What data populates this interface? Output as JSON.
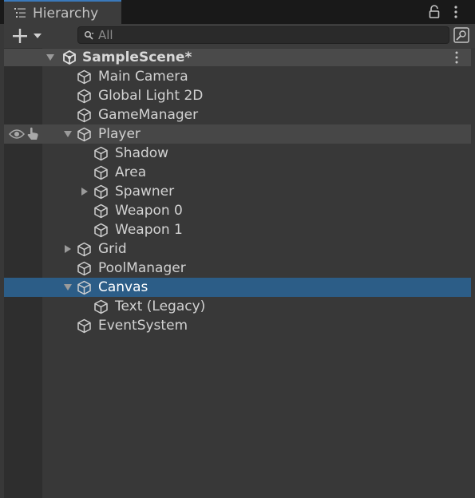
{
  "tab": {
    "title": "Hierarchy",
    "icon": "hierarchy-list-icon"
  },
  "toolbar": {
    "add_icon": "plus-icon",
    "dropdown_icon": "chevron-down-icon",
    "search_placeholder": "All",
    "search_value": "",
    "search_mode_icon": "search-mode-icon"
  },
  "header": {
    "lock_icon": "lock-icon",
    "menu_icon": "kebab-menu-icon"
  },
  "scene": {
    "name": "SampleScene*",
    "icon": "unity-scene-icon",
    "menu_icon": "kebab-menu-icon"
  },
  "items": [
    {
      "label": "Main Camera",
      "depth": 0,
      "arrow": "none",
      "icon": "gameobject-cube-icon"
    },
    {
      "label": "Global Light 2D",
      "depth": 0,
      "arrow": "none",
      "icon": "gameobject-cube-icon"
    },
    {
      "label": "GameManager",
      "depth": 0,
      "arrow": "none",
      "icon": "gameobject-cube-icon"
    },
    {
      "label": "Player",
      "depth": 0,
      "arrow": "expanded",
      "icon": "gameobject-cube-icon",
      "hovered": true
    },
    {
      "label": "Shadow",
      "depth": 1,
      "arrow": "none",
      "icon": "gameobject-cube-icon"
    },
    {
      "label": "Area",
      "depth": 1,
      "arrow": "none",
      "icon": "gameobject-cube-icon"
    },
    {
      "label": "Spawner",
      "depth": 1,
      "arrow": "collapsed",
      "icon": "gameobject-cube-icon"
    },
    {
      "label": "Weapon 0",
      "depth": 1,
      "arrow": "none",
      "icon": "gameobject-cube-icon"
    },
    {
      "label": "Weapon 1",
      "depth": 1,
      "arrow": "none",
      "icon": "gameobject-cube-icon"
    },
    {
      "label": "Grid",
      "depth": 0,
      "arrow": "collapsed",
      "icon": "gameobject-cube-icon"
    },
    {
      "label": "PoolManager",
      "depth": 0,
      "arrow": "none",
      "icon": "gameobject-cube-icon"
    },
    {
      "label": "Canvas",
      "depth": 0,
      "arrow": "expanded",
      "icon": "gameobject-cube-icon",
      "selected": true
    },
    {
      "label": "Text (Legacy)",
      "depth": 1,
      "arrow": "none",
      "icon": "gameobject-cube-icon"
    },
    {
      "label": "EventSystem",
      "depth": 0,
      "arrow": "none",
      "icon": "gameobject-cube-icon"
    }
  ],
  "visibility_icons": {
    "eye": "eye-visibility-icon",
    "pick": "pointer-pickable-icon"
  },
  "colors": {
    "selected_row": "#2c5d87",
    "hover_row": "#474747",
    "panel_bg": "#383838",
    "scene_header": "#4a4a4a",
    "tab_accent": "#3a79bb"
  }
}
